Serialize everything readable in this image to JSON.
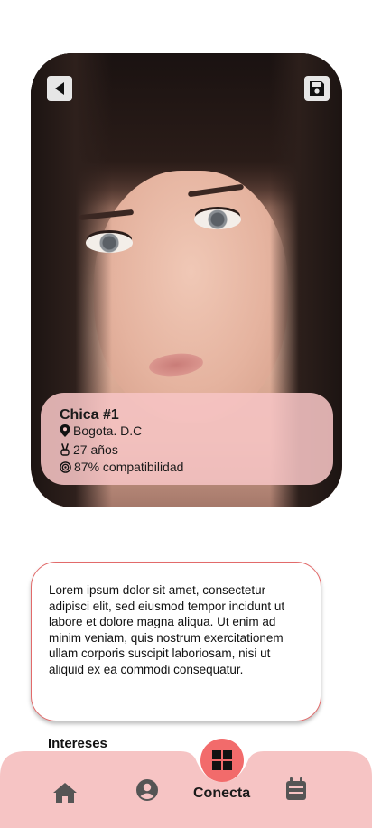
{
  "profile": {
    "name": "Chica #1",
    "location": "Bogota. D.C",
    "age": "27 años",
    "compatibility": "87% compatibilidad"
  },
  "description": "Lorem ipsum dolor sit amet, consectetur adipisci elit, sed eiusmod tempor incidunt ut labore et dolore magna aliqua. Ut enim ad minim veniam, quis nostrum exercitationem ullam corporis suscipit laboriosam, nisi ut aliquid ex ea commodi consequatur.",
  "interests_title": "Intereses",
  "nav": {
    "connect_label": "Conecta",
    "items": [
      "home-icon",
      "profile-icon",
      "connect-icon",
      "calendar-icon"
    ]
  },
  "icons": {
    "back": "back-arrow-icon",
    "save": "save-icon",
    "location": "location-pin-icon",
    "age": "victory-hand-icon",
    "compatibility": "target-icon"
  },
  "colors": {
    "accent": "#f26b6b",
    "info_panel": "#f6c4c4",
    "nav_bar": "#f6c4c4",
    "border": "#e26a6a"
  }
}
